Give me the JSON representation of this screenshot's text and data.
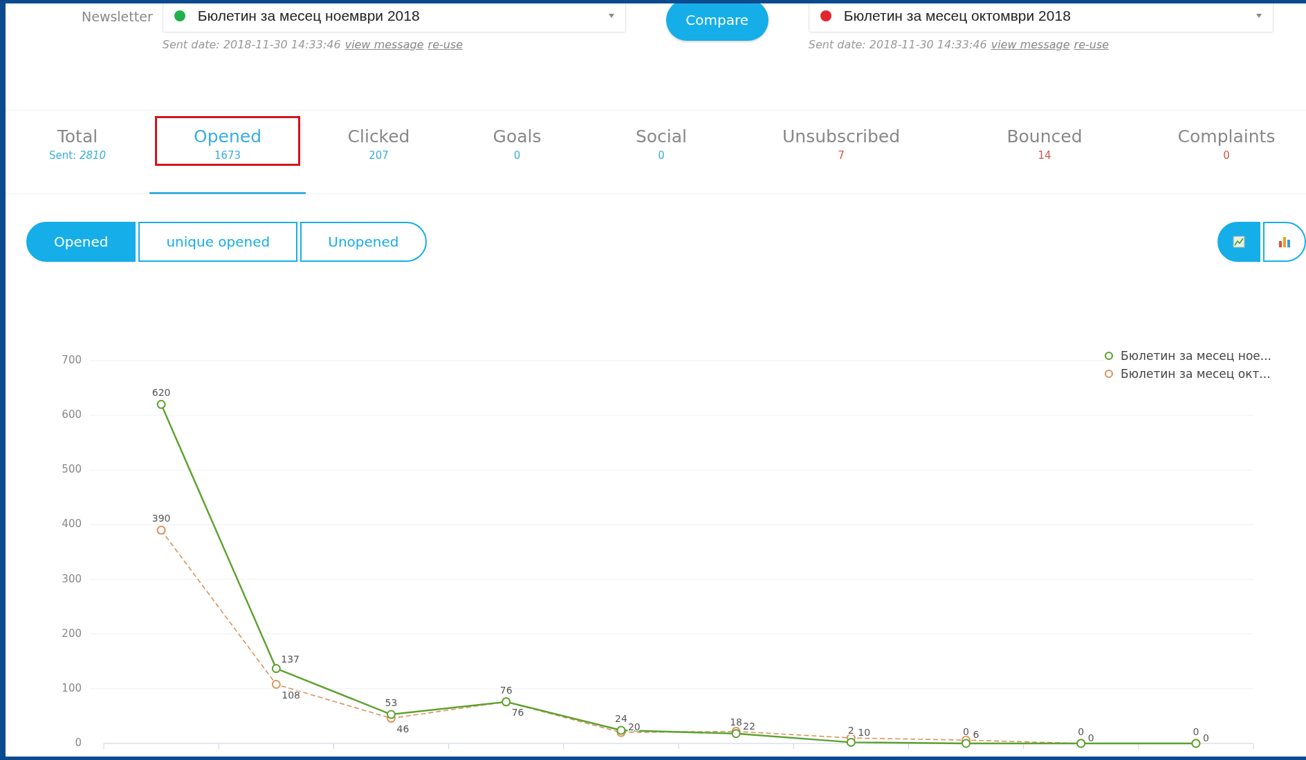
{
  "newsletter_row": {
    "label": "Newsletter",
    "left": {
      "title": "Бюлетин за месец ноември 2018",
      "color": "#1fb14a",
      "sent_label": "Sent date: 2018-11-30 14:33:46",
      "view_link": "view message",
      "reuse_link": "re-use"
    },
    "compare_button": "Compare",
    "right": {
      "title": "Бюлетин за месец октомври 2018",
      "color": "#e2262d",
      "sent_label": "Sent date: 2018-11-30 14:33:46",
      "view_link": "view message",
      "reuse_link": "re-use"
    }
  },
  "tabs": [
    {
      "label": "Total",
      "count": "Sent: *2810*",
      "color": "#3aaee0",
      "selected": false,
      "highlighted": false
    },
    {
      "label": "Opened",
      "count": "1673",
      "color": "#3aaee0",
      "selected": true,
      "highlighted": true
    },
    {
      "label": "Clicked",
      "count": "207",
      "color": "#3aaee0",
      "selected": false,
      "highlighted": false
    },
    {
      "label": "Goals",
      "count": "0",
      "color": "#3aaee0",
      "selected": false,
      "highlighted": false
    },
    {
      "label": "Social",
      "count": "0",
      "color": "#3aaee0",
      "selected": false,
      "highlighted": false
    },
    {
      "label": "Unsubscribed",
      "count": "7",
      "color": "#d9534f",
      "selected": false,
      "highlighted": false
    },
    {
      "label": "Bounced",
      "count": "14",
      "color": "#d9534f",
      "selected": false,
      "highlighted": false
    },
    {
      "label": "Complaints",
      "count": "0",
      "color": "#d9534f",
      "selected": false,
      "highlighted": false
    }
  ],
  "filters": [
    {
      "label": "Opened",
      "selected": true
    },
    {
      "label": "unique opened",
      "selected": false
    },
    {
      "label": "Unopened",
      "selected": false
    }
  ],
  "chart_types": [
    {
      "kind": "line",
      "selected": true
    },
    {
      "kind": "bar",
      "selected": false
    }
  ],
  "chart_data": {
    "type": "line",
    "ylim": [
      0,
      700
    ],
    "yticks": [
      0,
      100,
      200,
      300,
      400,
      500,
      600,
      700
    ],
    "data_labels": true,
    "grid": true,
    "legend": true,
    "series": [
      {
        "name": "Бюлетин за месец ное...",
        "color": "#5ba12e",
        "marker": "circle",
        "line_style": "solid",
        "values": [
          620,
          137,
          53,
          76,
          24,
          18,
          2,
          0,
          0,
          0
        ]
      },
      {
        "name": "Бюлетин за месец окт...",
        "color": "#d9935d",
        "marker": "circle",
        "line_style": "dashed",
        "values": [
          390,
          108,
          46,
          76,
          20,
          22,
          10,
          6,
          0,
          0
        ]
      }
    ]
  }
}
